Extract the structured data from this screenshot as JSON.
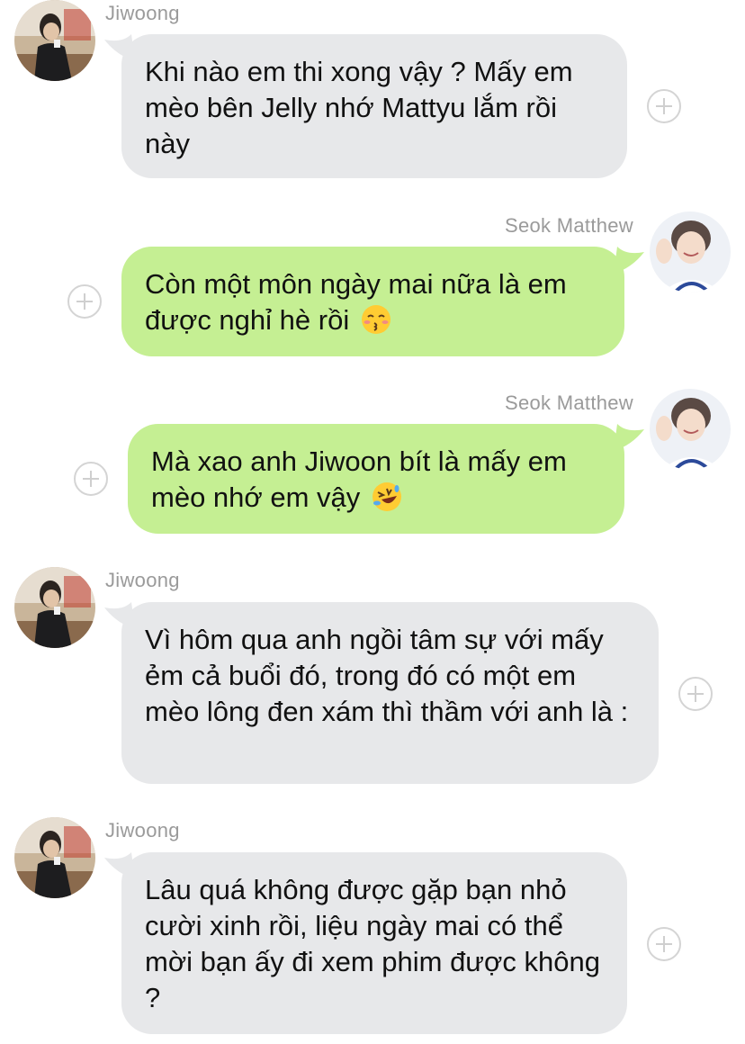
{
  "messages": [
    {
      "sender": "Jiwoong",
      "direction": "incoming",
      "text": "Khi nào em thi xong vậy ? Mấy em mèo bên Jelly nhớ Mattyu lắm rồi này",
      "avatar_icon": "man-holding-cup-photo"
    },
    {
      "sender": "Seok Matthew",
      "direction": "outgoing",
      "text": "Còn một môn ngày mai nữa là em được nghỉ hè rồi",
      "emoji": "kissing-face-with-closed-eyes",
      "avatar_icon": "smiling-boy-waving-photo"
    },
    {
      "sender": "Seok Matthew",
      "direction": "outgoing",
      "text": "Mà xao anh Jiwoon bít là mấy em mèo nhớ em vậy",
      "emoji": "rolling-on-the-floor-laughing",
      "avatar_icon": "smiling-boy-waving-photo"
    },
    {
      "sender": "Jiwoong",
      "direction": "incoming",
      "text": "Vì hôm qua anh ngồi tâm sự với mấy ẻm cả buổi đó, trong đó có một em mèo lông đen xám thì thầm với anh là :",
      "avatar_icon": "man-holding-cup-photo"
    },
    {
      "sender": "Jiwoong",
      "direction": "incoming",
      "text": "Lâu quá không được gặp bạn nhỏ cười xinh rồi, liệu ngày mai có thể mời bạn ấy đi xem phim được không ?",
      "avatar_icon": "man-holding-cup-photo"
    }
  ],
  "colors": {
    "incoming_bubble": "#e7e8ea",
    "outgoing_bubble": "#c5ef93",
    "sender_name": "#9a9a9a",
    "message_text": "#111111",
    "add_reaction_icon": "#cfcfcf"
  },
  "icons": {
    "add_reaction": "plus-circle-icon"
  }
}
